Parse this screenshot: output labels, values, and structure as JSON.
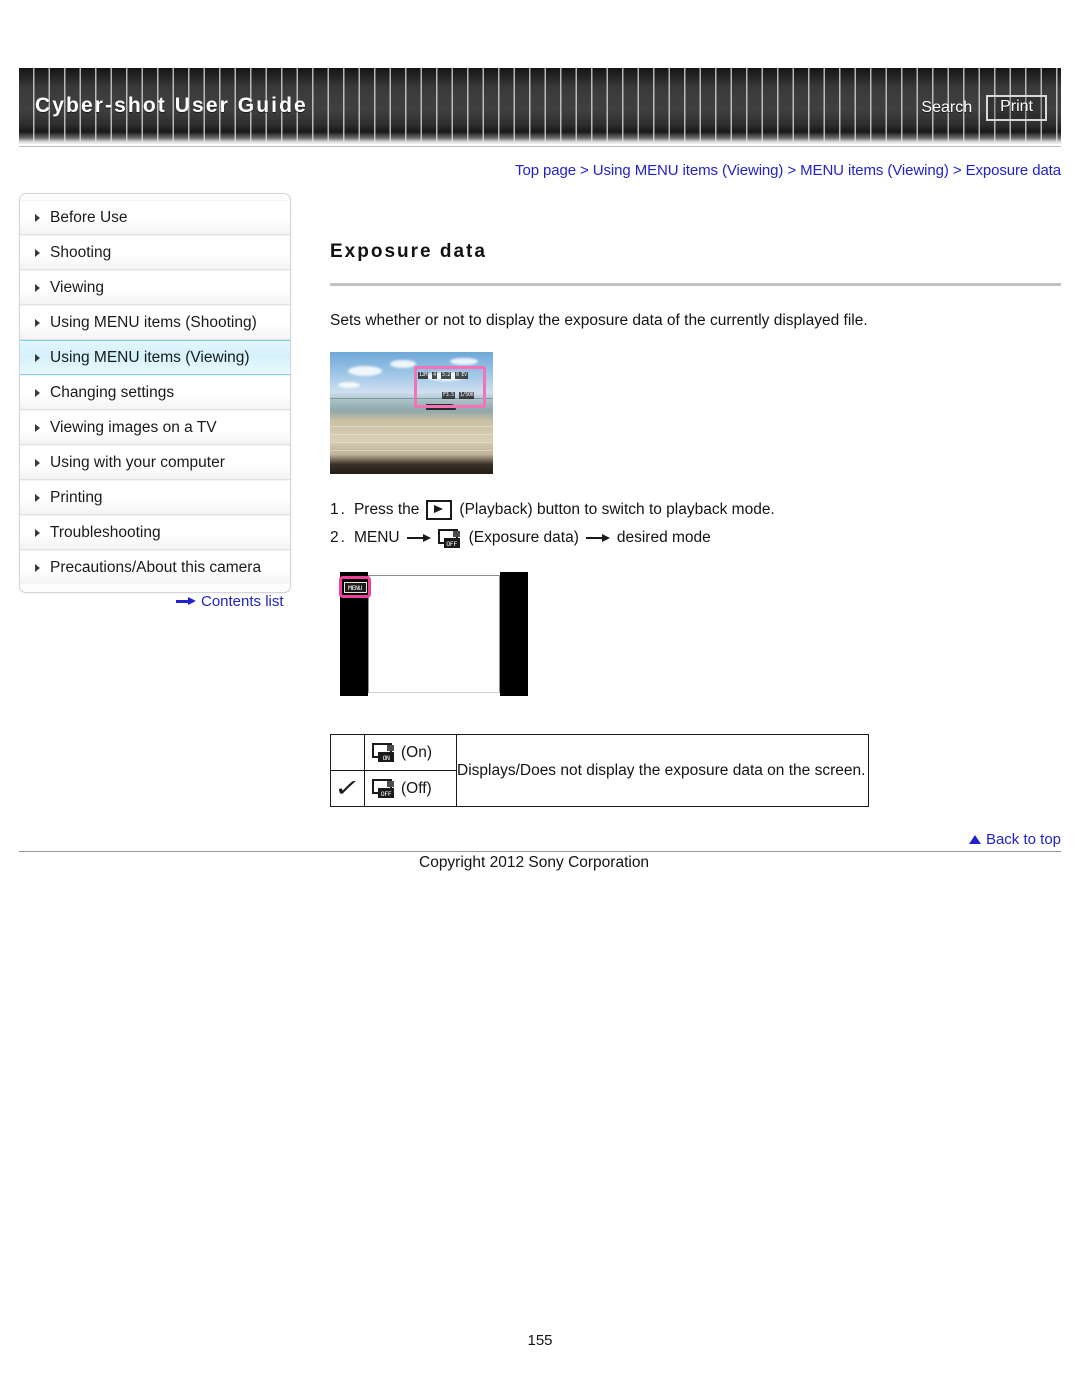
{
  "header": {
    "title": "Cyber-shot User Guide",
    "search_label": "Search",
    "print_label": "Print"
  },
  "breadcrumb": {
    "full": "Top page > Using MENU items (Viewing) > MENU items (Viewing) > Exposure data",
    "items": [
      "Top page",
      "Using MENU items (Viewing)",
      "MENU items (Viewing)",
      "Exposure data"
    ],
    "separator": ">"
  },
  "sidebar": {
    "items": [
      {
        "label": "Before Use",
        "selected": false
      },
      {
        "label": "Shooting",
        "selected": false
      },
      {
        "label": "Viewing",
        "selected": false
      },
      {
        "label": "Using MENU items (Shooting)",
        "selected": false
      },
      {
        "label": "Using MENU items (Viewing)",
        "selected": true
      },
      {
        "label": "Changing settings",
        "selected": false
      },
      {
        "label": "Viewing images on a TV",
        "selected": false
      },
      {
        "label": "Using with your computer",
        "selected": false
      },
      {
        "label": "Printing",
        "selected": false
      },
      {
        "label": "Troubleshooting",
        "selected": false
      },
      {
        "label": "Precautions/About this camera",
        "selected": false
      }
    ],
    "contents_list_label": "Contents list"
  },
  "main": {
    "title": "Exposure data",
    "lead": "Sets whether or not to display the exposure data of the currently displayed file.",
    "sample_image": {
      "alt": "Beach and sea photo with exposure data overlay highlighted",
      "overlay_top": [
        "12M",
        "4",
        "3:2",
        "0 EV"
      ],
      "overlay_bottom": [
        "F3.5",
        "1/500",
        "ISO 100"
      ]
    },
    "steps": [
      {
        "number": "1.",
        "text_before_icon": "Press the",
        "icon": "playback-icon",
        "text_after_icon": "(Playback) button to switch to playback mode."
      },
      {
        "number": "2.",
        "menu_label": "MENU",
        "icon": "exposure-data-icon",
        "icon_caption": "(Exposure data)",
        "final_text": "desired mode"
      }
    ],
    "menu_mock": {
      "button_label": "MENU"
    },
    "table": {
      "rows": [
        {
          "checked": false,
          "icon": "exposure-data-on-icon",
          "label": "(On)"
        },
        {
          "checked": true,
          "icon": "exposure-data-off-icon",
          "label": "(Off)"
        }
      ],
      "description": "Displays/Does not display the exposure data on the screen.",
      "check_glyph": "✓"
    }
  },
  "footer": {
    "back_to_top_label": "Back to top",
    "copyright": "Copyright 2012 Sony Corporation",
    "page_number": "155"
  },
  "colors": {
    "link": "#2222CC",
    "highlight_pink": "#F0409A",
    "selected_nav": "#D4F1FB",
    "header_dark": "#303030"
  }
}
